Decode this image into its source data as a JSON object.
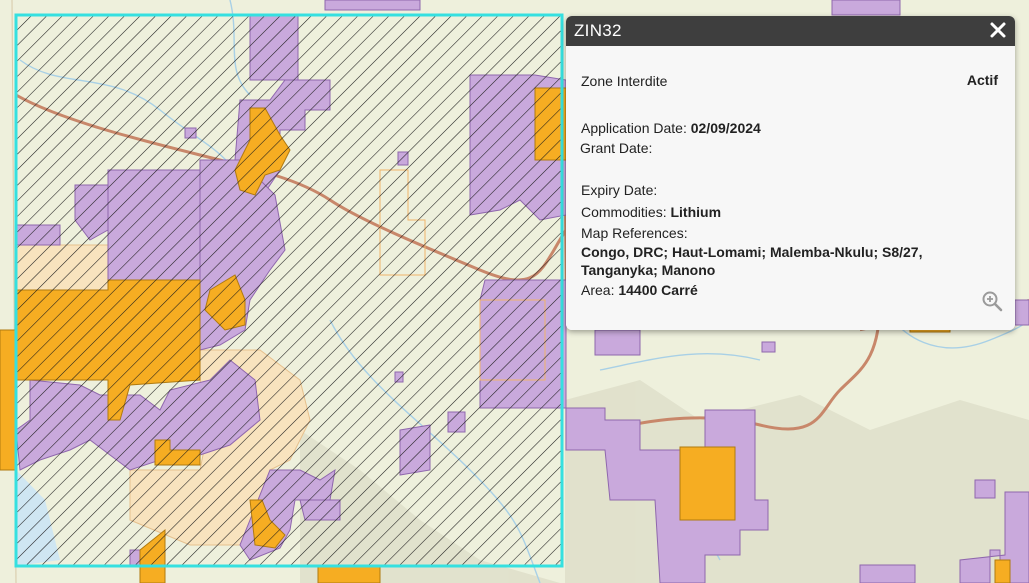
{
  "popup": {
    "title": "ZIN32",
    "type": "Zone Interdite",
    "status": "Actif",
    "application_date_label": "Application Date:",
    "application_date": "02/09/2024",
    "grant_date_label": "Grant Date:",
    "grant_date": "",
    "expiry_date_label": "Expiry Date:",
    "expiry_date": "",
    "commodities_label": "Commodities:",
    "commodities": "Lithium",
    "map_references_label": "Map References:",
    "map_references_line1": "Congo, DRC; Haut-Lomami; Malemba-Nkulu; S8/27,",
    "map_references_line2": "Tanganyka; Manono",
    "area_label": "Area:",
    "area": "14400 Carré",
    "close_icon": "close-icon",
    "zoom_icon": "zoom-in-icon"
  },
  "map": {
    "colors": {
      "basemap": "#eef0dc",
      "license_purple": "#c9a9dc",
      "license_orange": "#f6ad22",
      "application_pale": "#f8e3be",
      "selection_outline": "#35e0e0",
      "road": "#c8876a",
      "river": "#a8d0e6"
    }
  }
}
